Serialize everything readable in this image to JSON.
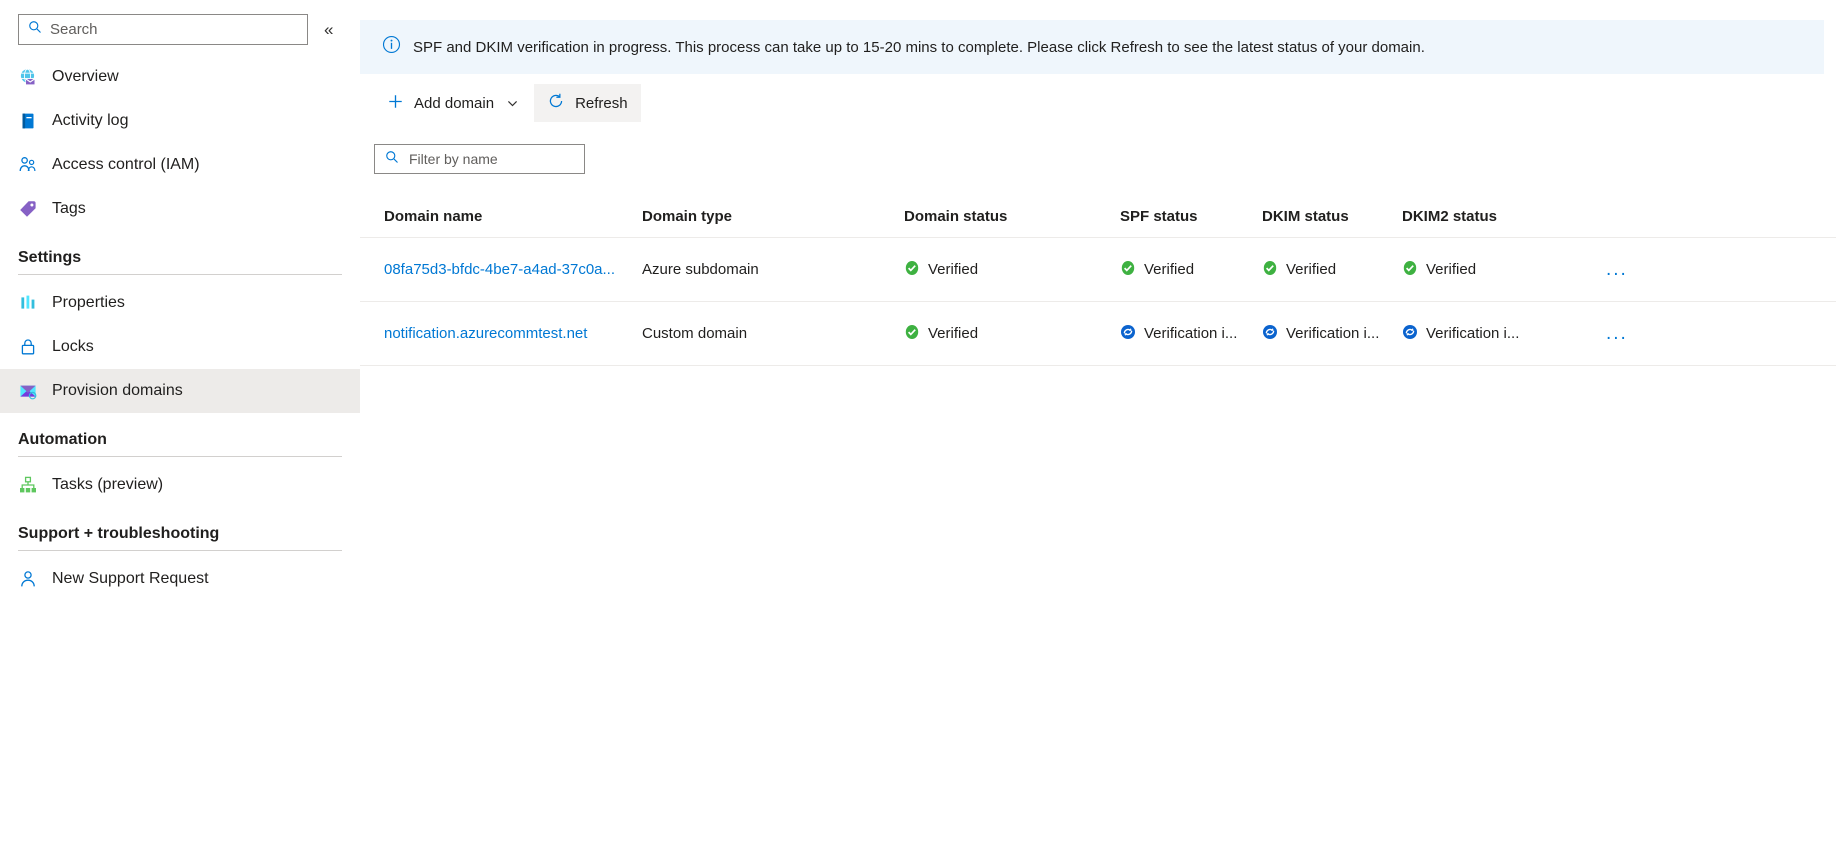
{
  "sidebar": {
    "search": {
      "placeholder": "Search",
      "icon": "search-icon"
    },
    "collapse": {
      "glyph": "«",
      "name": "collapse-sidebar"
    },
    "items": [
      {
        "label": "Overview",
        "icon": "overview-globe-mail-icon",
        "selected": false
      },
      {
        "label": "Activity log",
        "icon": "activity-log-icon",
        "selected": false
      },
      {
        "label": "Access control (IAM)",
        "icon": "access-control-people-icon",
        "selected": false
      },
      {
        "label": "Tags",
        "icon": "tags-icon",
        "selected": false
      }
    ],
    "groups": [
      {
        "title": "Settings",
        "items": [
          {
            "label": "Properties",
            "icon": "properties-bars-icon",
            "selected": false
          },
          {
            "label": "Locks",
            "icon": "lock-icon",
            "selected": false
          },
          {
            "label": "Provision domains",
            "icon": "provision-domains-mail-icon",
            "selected": true
          }
        ]
      },
      {
        "title": "Automation",
        "items": [
          {
            "label": "Tasks (preview)",
            "icon": "tasks-hierarchy-icon",
            "selected": false
          }
        ]
      },
      {
        "title": "Support + troubleshooting",
        "items": [
          {
            "label": "New Support Request",
            "icon": "support-person-icon",
            "selected": false
          }
        ]
      }
    ]
  },
  "banner": {
    "icon": "info-icon",
    "text": "SPF and DKIM verification in progress. This process can take up to 15-20 mins to complete. Please click Refresh to see the latest status of your domain.",
    "background": "#eff6fc"
  },
  "toolbar": {
    "add_domain_label": "Add domain",
    "add_domain_icon": "plus-icon",
    "add_domain_chevron": "chevron-down-icon",
    "refresh_label": "Refresh",
    "refresh_icon": "refresh-icon"
  },
  "filter": {
    "placeholder": "Filter by name",
    "value": "",
    "icon": "search-icon"
  },
  "table": {
    "columns": [
      "Domain name",
      "Domain type",
      "Domain status",
      "SPF status",
      "DKIM status",
      "DKIM2 status"
    ],
    "rows": [
      {
        "domain_name": "08fa75d3-bfdc-4be7-a4ad-37c0a...",
        "domain_type": "Azure subdomain",
        "domain_status": "Verified",
        "domain_status_icon": "verified-check-icon",
        "spf_status": "Verified",
        "spf_status_icon": "verified-check-icon",
        "dkim_status": "Verified",
        "dkim_status_icon": "verified-check-icon",
        "dkim2_status": "Verified",
        "dkim2_status_icon": "verified-check-icon",
        "menu": "..."
      },
      {
        "domain_name": "notification.azurecommtest.net",
        "domain_type": "Custom domain",
        "domain_status": "Verified",
        "domain_status_icon": "verified-check-icon",
        "spf_status": "Verification i...",
        "spf_status_icon": "in-progress-sync-icon",
        "dkim_status": "Verification i...",
        "dkim_status_icon": "in-progress-sync-icon",
        "dkim2_status": "Verification i...",
        "dkim2_status_icon": "in-progress-sync-icon",
        "menu": "..."
      }
    ]
  },
  "colors": {
    "accent_blue": "#0078d4",
    "success_green": "#3eb141",
    "in_progress_blue": "#0b63ce",
    "banner_bg": "#eff6fc",
    "selected_nav_bg": "#edebe9"
  }
}
